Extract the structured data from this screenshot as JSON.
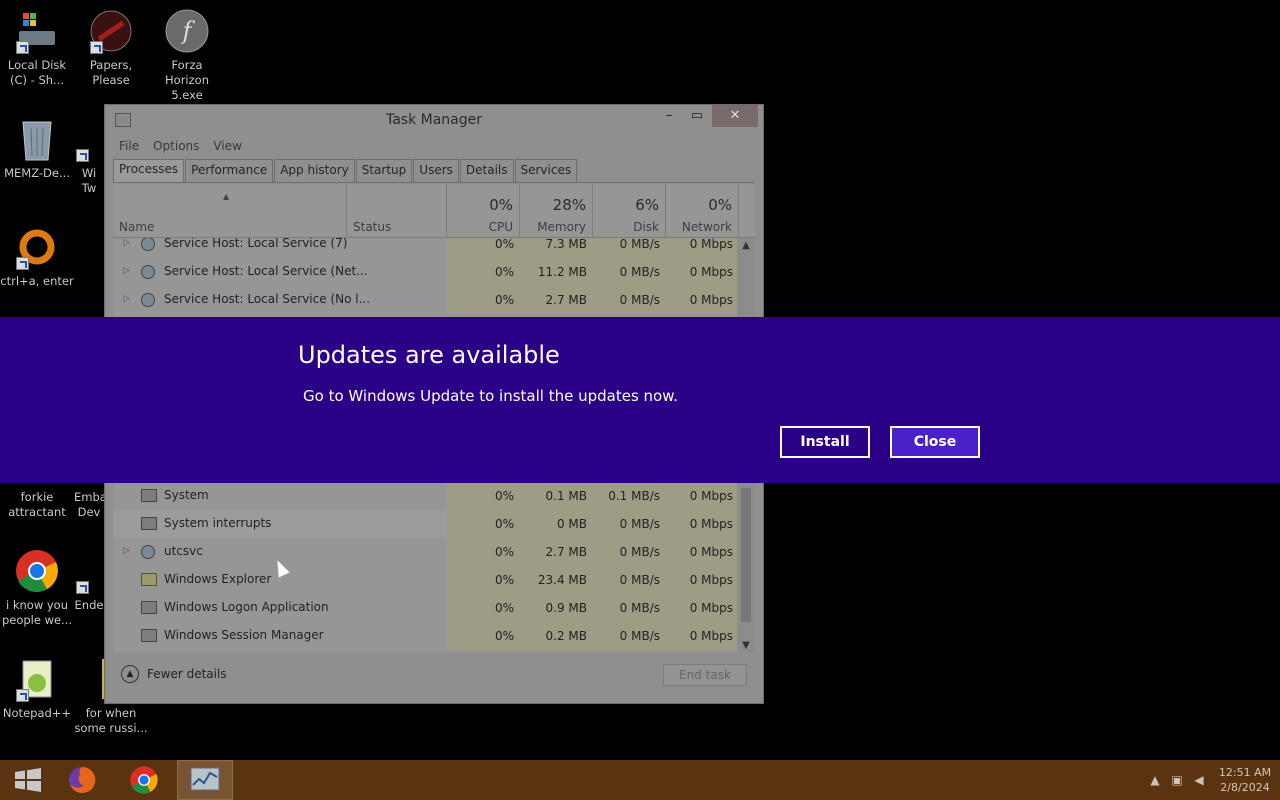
{
  "desktop": {
    "icons": [
      {
        "label": "Local Disk (C) - Sh...",
        "icon": "drive-icon"
      },
      {
        "label": "Papers, Please",
        "icon": "papers-please-icon"
      },
      {
        "label": "Forza Horizon 5.exe",
        "icon": "flash-icon"
      },
      {
        "label": "MEMZ-De...",
        "icon": "recycle-bin-icon"
      },
      {
        "label": "Wi Tw",
        "icon": "app-icon"
      },
      {
        "label": "ctrl+a, enter",
        "icon": "ring-icon"
      },
      {
        "label": "forkie attractant",
        "icon": "app-icon"
      },
      {
        "label": "Emba Dev",
        "icon": "app-icon"
      },
      {
        "label": "i know you people we...",
        "icon": "chrome-icon"
      },
      {
        "label": "Ende",
        "icon": "app-icon"
      },
      {
        "label": "Notepad++",
        "icon": "notepad-plus-plus-icon"
      },
      {
        "label": "for when some russi...",
        "icon": "app-icon"
      }
    ]
  },
  "task_manager": {
    "title": "Task Manager",
    "menu": [
      "File",
      "Options",
      "View"
    ],
    "tabs": [
      "Processes",
      "Performance",
      "App history",
      "Startup",
      "Users",
      "Details",
      "Services"
    ],
    "active_tab": "Processes",
    "columns": {
      "name": "Name",
      "status": "Status",
      "cpu": {
        "pct": "0%",
        "label": "CPU"
      },
      "memory": {
        "pct": "28%",
        "label": "Memory"
      },
      "disk": {
        "pct": "6%",
        "label": "Disk"
      },
      "network": {
        "pct": "0%",
        "label": "Network"
      }
    },
    "rows_top": [
      {
        "name": "Service Host: Local Service (7)",
        "cpu": "0%",
        "mem": "7.3 MB",
        "disk": "0 MB/s",
        "net": "0 Mbps"
      },
      {
        "name": "Service Host: Local Service (Net...",
        "cpu": "0%",
        "mem": "11.2 MB",
        "disk": "0 MB/s",
        "net": "0 Mbps"
      },
      {
        "name": "Service Host: Local Service (No l...",
        "cpu": "0%",
        "mem": "2.7 MB",
        "disk": "0 MB/s",
        "net": "0 Mbps"
      }
    ],
    "rows_bottom": [
      {
        "name": "System",
        "cpu": "0%",
        "mem": "0.1 MB",
        "disk": "0.1 MB/s",
        "net": "0 Mbps"
      },
      {
        "name": "System interrupts",
        "cpu": "0%",
        "mem": "0 MB",
        "disk": "0 MB/s",
        "net": "0 Mbps"
      },
      {
        "name": "utcsvc",
        "cpu": "0%",
        "mem": "2.7 MB",
        "disk": "0 MB/s",
        "net": "0 Mbps"
      },
      {
        "name": "Windows Explorer",
        "cpu": "0%",
        "mem": "23.4 MB",
        "disk": "0 MB/s",
        "net": "0 Mbps"
      },
      {
        "name": "Windows Logon Application",
        "cpu": "0%",
        "mem": "0.9 MB",
        "disk": "0 MB/s",
        "net": "0 Mbps"
      },
      {
        "name": "Windows Session Manager",
        "cpu": "0%",
        "mem": "0.2 MB",
        "disk": "0 MB/s",
        "net": "0 Mbps"
      }
    ],
    "fewer_details": "Fewer details",
    "end_task": "End task"
  },
  "banner": {
    "title": "Updates are available",
    "message": "Go to Windows Update to install the updates now.",
    "install_label": "Install",
    "close_label": "Close",
    "bg_color": "#2a0087"
  },
  "taskbar": {
    "clock_time": "12:51 AM",
    "clock_date": "2/8/2024",
    "color": "#5a3410"
  }
}
